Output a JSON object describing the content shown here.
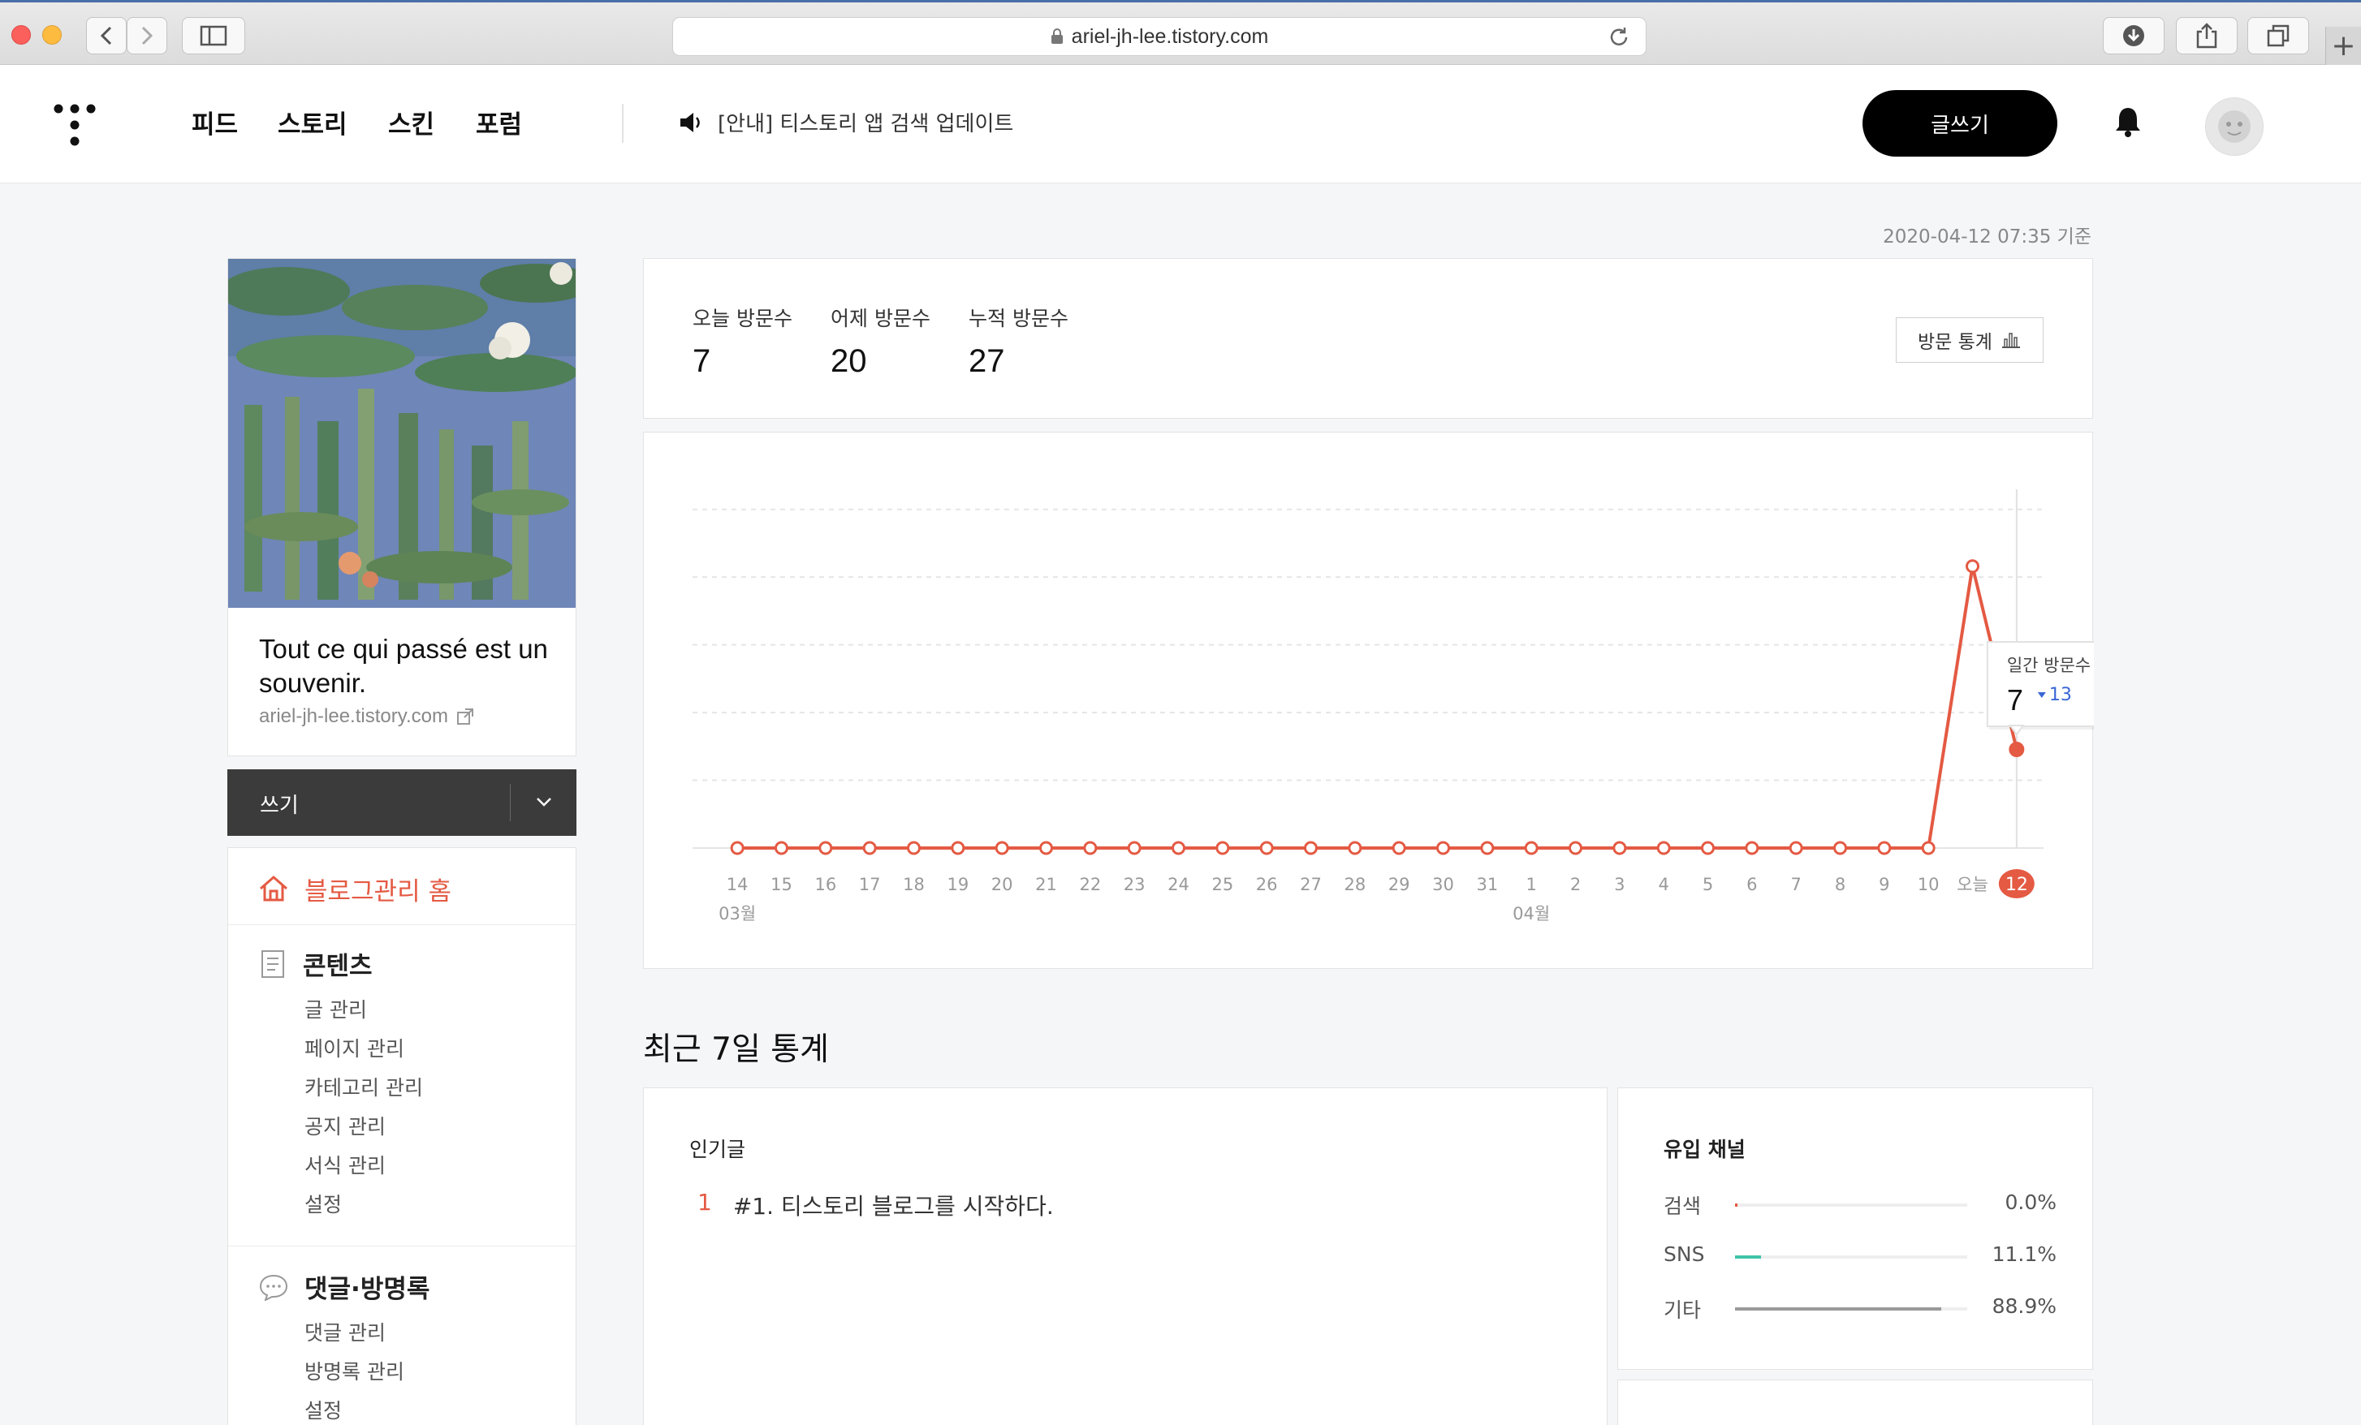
{
  "browser": {
    "url": "ariel-jh-lee.tistory.com",
    "new_tab_label": "+"
  },
  "header": {
    "nav": [
      "피드",
      "스토리",
      "스킨",
      "포럼"
    ],
    "notice": "[안내] 티스토리 앱 검색 업데이트",
    "write_button": "글쓰기",
    "icons": {
      "logo": "tistory-logo",
      "notice": "speaker-icon",
      "bell": "bell-icon",
      "avatar": "avatar-icon"
    }
  },
  "sidebar": {
    "blog_title": "Tout ce qui passé est un souvenir.",
    "blog_url": "ariel-jh-lee.tistory.com",
    "write_bar_label": "쓰기",
    "home_label": "블로그관리 홈",
    "sections": [
      {
        "title": "콘텐츠",
        "icon": "document-icon",
        "items": [
          "글 관리",
          "페이지 관리",
          "카테고리 관리",
          "공지 관리",
          "서식 관리",
          "설정"
        ]
      },
      {
        "title": "댓글·방명록",
        "icon": "speech-bubble-icon",
        "items": [
          "댓글 관리",
          "방명록 관리",
          "설정"
        ]
      }
    ]
  },
  "main": {
    "timestamp": "2020-04-12 07:35 기준",
    "stats": [
      {
        "label": "오늘 방문수",
        "value": "7"
      },
      {
        "label": "어제 방문수",
        "value": "20"
      },
      {
        "label": "누적 방문수",
        "value": "27"
      }
    ],
    "stats_button": "방문 통계",
    "tooltip": {
      "label": "일간 방문수",
      "value": "7",
      "change": "13",
      "change_dir": "down"
    },
    "recent_title": "최근 7일 통계",
    "popular": {
      "title": "인기글",
      "items": [
        {
          "rank": "1",
          "title": "#1. 티스토리 블로그를 시작하다."
        }
      ]
    },
    "inflow": {
      "title": "유입 채널",
      "rows": [
        {
          "name": "검색",
          "pct": "0.0%",
          "value": 0.0,
          "color": "#e45a43"
        },
        {
          "name": "SNS",
          "pct": "11.1%",
          "value": 11.1,
          "color": "#3ec5a8"
        },
        {
          "name": "기타",
          "pct": "88.9%",
          "value": 88.9,
          "color": "#999999"
        }
      ]
    }
  },
  "chart_data": {
    "type": "line",
    "x": [
      "14",
      "15",
      "16",
      "17",
      "18",
      "19",
      "20",
      "21",
      "22",
      "23",
      "24",
      "25",
      "26",
      "27",
      "28",
      "29",
      "30",
      "31",
      "1",
      "2",
      "3",
      "4",
      "5",
      "6",
      "7",
      "8",
      "9",
      "10",
      "오늘",
      "12"
    ],
    "values": [
      0,
      0,
      0,
      0,
      0,
      0,
      0,
      0,
      0,
      0,
      0,
      0,
      0,
      0,
      0,
      0,
      0,
      0,
      0,
      0,
      0,
      0,
      0,
      0,
      0,
      0,
      0,
      0,
      20,
      7
    ],
    "month_labels": [
      {
        "text": "03월",
        "at": "14"
      },
      {
        "text": "04월",
        "at": "1"
      }
    ],
    "highlight_label": "12",
    "ylim": [
      0,
      25
    ],
    "grid": true,
    "line_color": "#e45a43"
  }
}
